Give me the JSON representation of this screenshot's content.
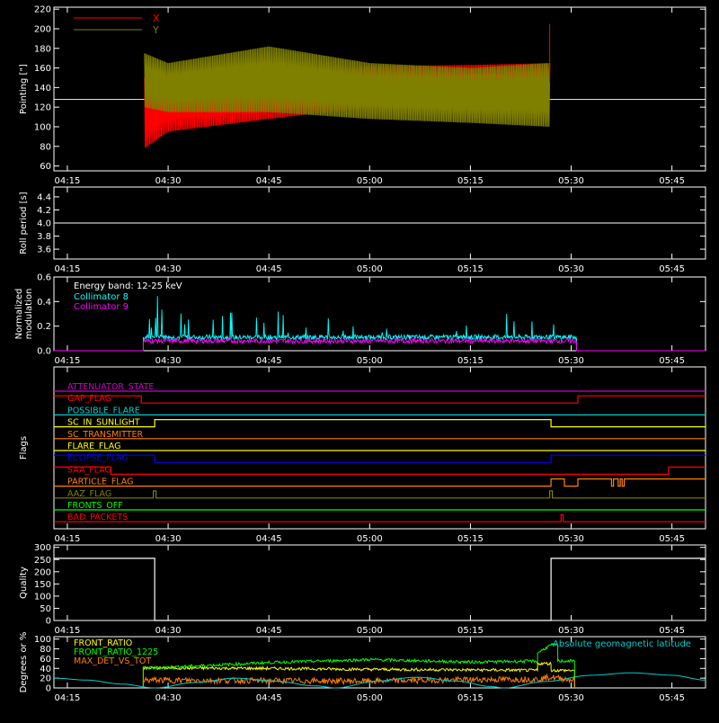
{
  "time_axis": {
    "start_min": 253,
    "end_min": 350,
    "ticks": [
      {
        "label": "04:15",
        "min": 255
      },
      {
        "label": "04:30",
        "min": 270
      },
      {
        "label": "04:45",
        "min": 285
      },
      {
        "label": "05:00",
        "min": 300
      },
      {
        "label": "05:15",
        "min": 315
      },
      {
        "label": "05:30",
        "min": 330
      },
      {
        "label": "05:45",
        "min": 345
      }
    ]
  },
  "chart_data": [
    {
      "id": "pointing",
      "type": "line",
      "ylabel": "Pointing [\"]",
      "ylim": [
        55,
        222
      ],
      "yticks": [
        60,
        80,
        100,
        120,
        140,
        160,
        180,
        200,
        220
      ],
      "series": [
        {
          "name": "X",
          "color": "#ff0000"
        },
        {
          "name": "Y",
          "color": "#808000"
        }
      ],
      "reference_line": 128,
      "data_start_min": 266.5,
      "data_end_min": 326.8,
      "envelope_x": [
        {
          "t": 266.5,
          "lo": 78,
          "hi": 150
        },
        {
          "t": 270,
          "lo": 95,
          "hi": 150
        },
        {
          "t": 285,
          "lo": 108,
          "hi": 148
        },
        {
          "t": 300,
          "lo": 120,
          "hi": 162
        },
        {
          "t": 315,
          "lo": 120,
          "hi": 163
        },
        {
          "t": 326.8,
          "lo": 122,
          "hi": 165
        }
      ],
      "envelope_y": [
        {
          "t": 266.5,
          "lo": 120,
          "hi": 175
        },
        {
          "t": 270,
          "lo": 115,
          "hi": 165
        },
        {
          "t": 285,
          "lo": 115,
          "hi": 182
        },
        {
          "t": 300,
          "lo": 108,
          "hi": 165
        },
        {
          "t": 315,
          "lo": 104,
          "hi": 160
        },
        {
          "t": 326.8,
          "lo": 100,
          "hi": 165
        }
      ]
    },
    {
      "id": "roll",
      "type": "line",
      "ylabel": "Roll period [s]",
      "ylim": [
        3.45,
        4.55
      ],
      "yticks": [
        3.6,
        3.8,
        4.0,
        4.2,
        4.4
      ],
      "yticklabels": [
        "3.6",
        "3.8",
        "4.0",
        "4.2",
        "4.4"
      ],
      "value": 4.0
    },
    {
      "id": "modulation",
      "type": "line",
      "ylabel": "Normalized modulation",
      "ylabel_lines": [
        "Normalized",
        "modulation"
      ],
      "ylim": [
        0,
        0.6
      ],
      "yticks": [
        0,
        0.2,
        0.4,
        0.6
      ],
      "yticklabels": [
        "0.0",
        "0.2",
        "0.4",
        "0.6"
      ],
      "annotation": "Energy band: 12-25 keV",
      "series": [
        {
          "name": "Collimator 8",
          "color": "#00ffff",
          "mean": 0.11
        },
        {
          "name": "Collimator 9",
          "color": "#ff00ff",
          "mean": 0.08
        }
      ],
      "data_start_min": 266.3,
      "data_end_min": 330.8
    },
    {
      "id": "flags",
      "type": "line",
      "ylabel": "Flags",
      "flags": [
        {
          "name": "ATTENUATOR_STATE",
          "color": "#cc00cc",
          "steps": [
            [
              253,
              0
            ],
            [
              350,
              0
            ]
          ]
        },
        {
          "name": "GAP_FLAG",
          "color": "#ff0000",
          "steps": [
            [
              253,
              1
            ],
            [
              266,
              1
            ],
            [
              266,
              0
            ],
            [
              331,
              0
            ],
            [
              331,
              1
            ],
            [
              350,
              1
            ]
          ]
        },
        {
          "name": "POSSIBLE_FLARE",
          "color": "#00cccc",
          "steps": [
            [
              253,
              0
            ],
            [
              350,
              0
            ]
          ]
        },
        {
          "name": "SC_IN_SUNLIGHT",
          "color": "#ffff00",
          "steps": [
            [
              253,
              0
            ],
            [
              268,
              0
            ],
            [
              268,
              1
            ],
            [
              327,
              1
            ],
            [
              327,
              0
            ],
            [
              350,
              0
            ]
          ]
        },
        {
          "name": "SC_TRANSMITTER",
          "color": "#ff8000",
          "steps": [
            [
              253,
              0
            ],
            [
              350,
              0
            ]
          ]
        },
        {
          "name": "FLARE_FLAG",
          "color": "#ffff00",
          "steps": [
            [
              253,
              0
            ],
            [
              350,
              0
            ]
          ]
        },
        {
          "name": "ECLIPSE_FLAG",
          "color": "#0000ff",
          "steps": [
            [
              253,
              1
            ],
            [
              268,
              1
            ],
            [
              268,
              0
            ],
            [
              327,
              0
            ],
            [
              327,
              1
            ],
            [
              350,
              1
            ]
          ]
        },
        {
          "name": "SAA_FLAG",
          "color": "#ff0000",
          "steps": [
            [
              253,
              1
            ],
            [
              261.5,
              1
            ],
            [
              261.5,
              0
            ],
            [
              344.5,
              0
            ],
            [
              344.5,
              1
            ],
            [
              350,
              1
            ]
          ]
        },
        {
          "name": "PARTICLE_FLAG",
          "color": "#ff8000",
          "steps": [
            [
              253,
              0
            ],
            [
              327,
              0
            ],
            [
              327,
              1
            ],
            [
              329,
              1
            ],
            [
              329,
              0
            ],
            [
              331,
              0
            ],
            [
              331,
              1
            ],
            [
              336,
              1
            ],
            [
              336,
              0
            ],
            [
              336.3,
              0
            ],
            [
              336.3,
              1
            ],
            [
              337,
              1
            ],
            [
              337,
              0
            ],
            [
              337.3,
              0
            ],
            [
              337.3,
              1
            ],
            [
              337.6,
              1
            ],
            [
              337.6,
              0
            ],
            [
              337.9,
              0
            ],
            [
              337.9,
              1
            ],
            [
              350,
              1
            ]
          ]
        },
        {
          "name": "AAZ_FLAG",
          "color": "#808000",
          "steps": [
            [
              253,
              0
            ],
            [
              267.8,
              0
            ],
            [
              267.8,
              1
            ],
            [
              268.2,
              1
            ],
            [
              268.2,
              0
            ],
            [
              326.8,
              0
            ],
            [
              326.8,
              1
            ],
            [
              327.2,
              1
            ],
            [
              327.2,
              0
            ],
            [
              350,
              0
            ]
          ]
        },
        {
          "name": "FRONTS_OFF",
          "color": "#00ff00",
          "steps": [
            [
              253,
              0
            ],
            [
              350,
              0
            ]
          ]
        },
        {
          "name": "BAD_PACKETS",
          "color": "#ff0000",
          "steps": [
            [
              253,
              0
            ],
            [
              328.5,
              0
            ],
            [
              328.5,
              1
            ],
            [
              328.8,
              1
            ],
            [
              328.8,
              0
            ],
            [
              350,
              0
            ]
          ]
        }
      ]
    },
    {
      "id": "quality",
      "type": "line",
      "ylabel": "Quality",
      "ylim": [
        0,
        310
      ],
      "yticks": [
        0,
        50,
        100,
        150,
        200,
        250,
        300
      ],
      "steps": [
        [
          253,
          255
        ],
        [
          268,
          255
        ],
        [
          268,
          0
        ],
        [
          327,
          0
        ],
        [
          327,
          255
        ],
        [
          350,
          255
        ]
      ]
    },
    {
      "id": "ratios",
      "type": "line",
      "ylabel": "Degrees or %",
      "ylim": [
        0,
        105
      ],
      "yticks": [
        0,
        20,
        40,
        60,
        80,
        100
      ],
      "annotation": "Absolute geomagnetic latitude",
      "series": [
        {
          "name": "FRONT_RATIO",
          "color": "#ffff00",
          "points": [
            [
              266.3,
              41
            ],
            [
              285,
              40
            ],
            [
              300,
              38
            ],
            [
              315,
              37
            ],
            [
              325,
              36
            ],
            [
              325,
              50
            ],
            [
              327,
              50
            ],
            [
              327,
              36
            ],
            [
              330.5,
              36
            ]
          ]
        },
        {
          "name": "FRONT_RATIO_1225",
          "color": "#00ff00",
          "points": [
            [
              266.3,
              40
            ],
            [
              285,
              52
            ],
            [
              300,
              58
            ],
            [
              315,
              53
            ],
            [
              325,
              55
            ],
            [
              325,
              72
            ],
            [
              327,
              88
            ],
            [
              328,
              88
            ],
            [
              328,
              55
            ],
            [
              330.5,
              55
            ]
          ]
        },
        {
          "name": "MAX_DET_VS_TOT",
          "color": "#ff8000",
          "points": [
            [
              266.3,
              16
            ],
            [
              285,
              15
            ],
            [
              300,
              14
            ],
            [
              315,
              17
            ],
            [
              325,
              18
            ],
            [
              327,
              22
            ],
            [
              330.5,
              16
            ]
          ]
        },
        {
          "name": "Absolute geomagnetic latitude",
          "color": "#00cccc",
          "points": [
            [
              253,
              20
            ],
            [
              258,
              16
            ],
            [
              263,
              8
            ],
            [
              268,
              0
            ],
            [
              274,
              11
            ],
            [
              280,
              20
            ],
            [
              286,
              14
            ],
            [
              292,
              4
            ],
            [
              295,
              0
            ],
            [
              301,
              14
            ],
            [
              307,
              22
            ],
            [
              313,
              14
            ],
            [
              318,
              3
            ],
            [
              320,
              0
            ],
            [
              326,
              13
            ],
            [
              333,
              26
            ],
            [
              339,
              31
            ],
            [
              345,
              26
            ],
            [
              350,
              16
            ]
          ]
        }
      ]
    }
  ]
}
